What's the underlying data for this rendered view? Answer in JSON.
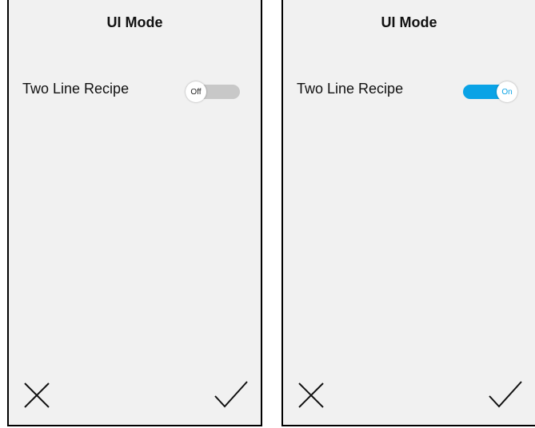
{
  "screens": [
    {
      "title": "UI Mode",
      "setting_label": "Two Line Recipe",
      "toggle": {
        "state": "off",
        "text": "Off"
      },
      "cancel_icon": "close-icon",
      "confirm_icon": "checkmark-icon"
    },
    {
      "title": "UI Mode",
      "setting_label": "Two Line Recipe",
      "toggle": {
        "state": "on",
        "text": "On"
      },
      "cancel_icon": "close-icon",
      "confirm_icon": "checkmark-icon"
    }
  ],
  "colors": {
    "panel_bg": "#f1f1f1",
    "toggle_on": "#0aa3e6",
    "toggle_off": "#c8c8c8"
  }
}
